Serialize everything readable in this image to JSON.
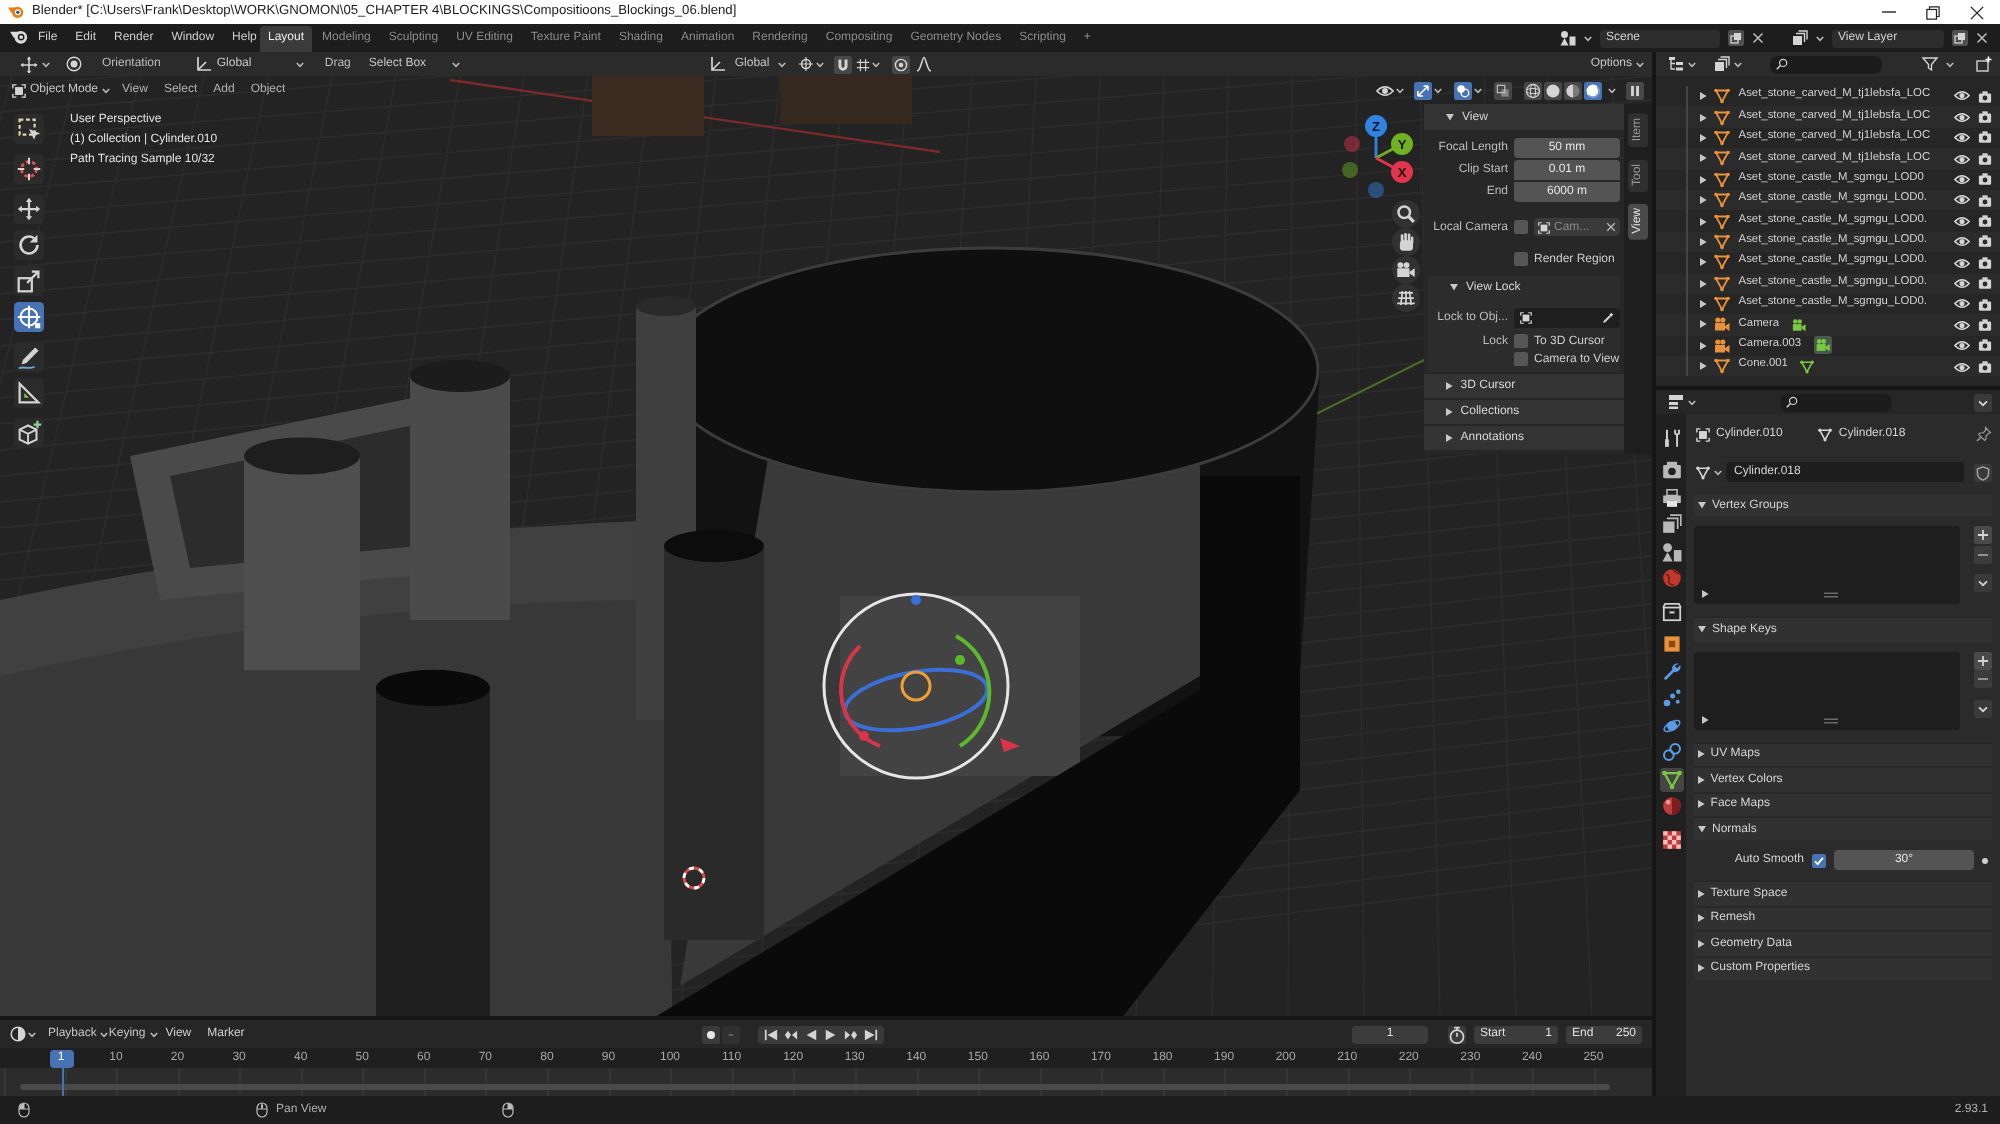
{
  "window": {
    "title": "Blender* [C:\\Users\\Frank\\Desktop\\WORK\\GNOMON\\05_CHAPTER 4\\BLOCKINGS\\Compositioons_Blockings_06.blend]"
  },
  "top_bar": {
    "menus": [
      "File",
      "Edit",
      "Render",
      "Window",
      "Help"
    ],
    "workspaces": [
      {
        "label": "Layout",
        "selected": true
      },
      {
        "label": "Modeling",
        "selected": false
      },
      {
        "label": "Sculpting",
        "selected": false
      },
      {
        "label": "UV Editing",
        "selected": false
      },
      {
        "label": "Texture Paint",
        "selected": false
      },
      {
        "label": "Shading",
        "selected": false
      },
      {
        "label": "Animation",
        "selected": false
      },
      {
        "label": "Rendering",
        "selected": false
      },
      {
        "label": "Compositing",
        "selected": false
      },
      {
        "label": "Geometry Nodes",
        "selected": false
      },
      {
        "label": "Scripting",
        "selected": false
      }
    ],
    "add_workspace": "+",
    "scene": "Scene",
    "view_layer": "View Layer"
  },
  "tool_settings": {
    "orientation_label": "Orientation",
    "orientation": "Global",
    "drag_label": "Drag",
    "drag": "Select Box",
    "transform_orientation": "Global",
    "snap": false,
    "proportional_editing": false,
    "options": "Options"
  },
  "viewport": {
    "mode": "Object Mode",
    "menus": [
      "View",
      "Select",
      "Add",
      "Object"
    ],
    "toggles": [
      {
        "kind": "gizmos",
        "on": true
      },
      {
        "kind": "overlays",
        "on": true
      },
      {
        "kind": "xray",
        "on": false
      }
    ],
    "shading": [
      {
        "kind": "wireframe",
        "selected": false
      },
      {
        "kind": "solid",
        "selected": false
      },
      {
        "kind": "material",
        "selected": false
      },
      {
        "kind": "rendered",
        "selected": true
      }
    ],
    "info": [
      "User Perspective",
      "(1) Collection | Cylinder.010",
      "Path Tracing Sample 10/32"
    ],
    "tool_groups": [
      [
        {
          "kind": "select-box",
          "selected": false
        }
      ],
      [
        {
          "kind": "cursor",
          "selected": false
        }
      ],
      [
        {
          "kind": "move",
          "selected": false
        },
        {
          "kind": "rotate",
          "selected": false
        },
        {
          "kind": "scale",
          "selected": false
        },
        {
          "kind": "transform",
          "selected": true
        }
      ],
      [
        {
          "kind": "annotate",
          "selected": false
        },
        {
          "kind": "measure",
          "selected": false
        }
      ],
      [
        {
          "kind": "add-cube",
          "selected": false
        }
      ]
    ],
    "axes": [
      {
        "label": "Z",
        "color": "#2f84e3"
      },
      {
        "label": "Y",
        "color": "#6fb122"
      },
      {
        "label": "X",
        "color": "#e3344d"
      }
    ]
  },
  "sidebar": {
    "tabs": [
      {
        "label": "Item",
        "selected": false
      },
      {
        "label": "Tool",
        "selected": false
      },
      {
        "label": "View",
        "selected": true
      }
    ],
    "view_panel": {
      "title": "View",
      "expanded": true,
      "fields": [
        {
          "label": "Focal Length",
          "value": "50 mm"
        },
        {
          "label": "Clip Start",
          "value": "0.01 m"
        },
        {
          "label": "End",
          "value": "6000 m"
        }
      ],
      "local_camera": {
        "label": "Local Camera",
        "checked": false,
        "value": "Cam...",
        "disabled": true
      },
      "render_region": {
        "label": "Render Region",
        "checked": false
      },
      "view_lock": {
        "title": "View Lock",
        "expanded": true,
        "lock_object_label": "Lock to Obj...",
        "lock_label": "Lock",
        "options": [
          {
            "label": "To 3D Cursor",
            "checked": false
          },
          {
            "label": "Camera to View",
            "checked": false
          }
        ]
      }
    },
    "panels": [
      {
        "title": "3D Cursor",
        "expanded": false
      },
      {
        "title": "Collections",
        "expanded": false
      },
      {
        "title": "Annotations",
        "expanded": false
      }
    ]
  },
  "outliner": {
    "rows": [
      {
        "name": "Aset_stone_carved_M_tj1lebsfa_LOC",
        "kind": "mesh"
      },
      {
        "name": "Aset_stone_carved_M_tj1lebsfa_LOC",
        "kind": "mesh"
      },
      {
        "name": "Aset_stone_carved_M_tj1lebsfa_LOC",
        "kind": "mesh"
      },
      {
        "name": "Aset_stone_carved_M_tj1lebsfa_LOC",
        "kind": "mesh"
      },
      {
        "name": "Aset_stone_castle_M_sgmgu_LOD0",
        "kind": "mesh"
      },
      {
        "name": "Aset_stone_castle_M_sgmgu_LOD0.",
        "kind": "mesh"
      },
      {
        "name": "Aset_stone_castle_M_sgmgu_LOD0.",
        "kind": "mesh"
      },
      {
        "name": "Aset_stone_castle_M_sgmgu_LOD0.",
        "kind": "mesh"
      },
      {
        "name": "Aset_stone_castle_M_sgmgu_LOD0.",
        "kind": "mesh"
      },
      {
        "name": "Aset_stone_castle_M_sgmgu_LOD0.",
        "kind": "mesh"
      },
      {
        "name": "Aset_stone_castle_M_sgmgu_LOD0.",
        "kind": "mesh"
      },
      {
        "name": "Camera",
        "kind": "camera",
        "data": {
          "active": false
        }
      },
      {
        "name": "Camera.003",
        "kind": "camera",
        "data": {
          "active": true
        }
      },
      {
        "name": "Cone.001",
        "kind": "mesh",
        "data": {
          "active": false
        }
      }
    ]
  },
  "properties": {
    "tab_groups": [
      [
        {
          "kind": "tool",
          "selected": false
        }
      ],
      [
        {
          "kind": "render",
          "selected": false
        },
        {
          "kind": "output",
          "selected": false
        },
        {
          "kind": "view-layer",
          "selected": false
        },
        {
          "kind": "scene",
          "selected": false
        },
        {
          "kind": "world",
          "selected": false
        }
      ],
      [
        {
          "kind": "collection",
          "selected": false
        }
      ],
      [
        {
          "kind": "object",
          "selected": false
        },
        {
          "kind": "modifiers",
          "selected": false
        },
        {
          "kind": "particles",
          "selected": false
        },
        {
          "kind": "physics",
          "selected": false
        },
        {
          "kind": "constraints",
          "selected": false
        },
        {
          "kind": "data",
          "selected": true
        },
        {
          "kind": "material",
          "selected": false
        }
      ],
      [
        {
          "kind": "texture",
          "selected": false
        }
      ]
    ],
    "object": "Cylinder.010",
    "mesh": "Cylinder.018",
    "datablock": "Cylinder.018",
    "panels": [
      {
        "title": "Vertex Groups",
        "expanded": true,
        "kind": "list"
      },
      {
        "title": "Shape Keys",
        "expanded": true,
        "kind": "list"
      },
      {
        "title": "UV Maps",
        "expanded": false
      },
      {
        "title": "Vertex Colors",
        "expanded": false
      },
      {
        "title": "Face Maps",
        "expanded": false
      },
      {
        "title": "Normals",
        "expanded": true,
        "kind": "normals",
        "auto_smooth": {
          "label": "Auto Smooth",
          "checked": true,
          "value": "30°"
        }
      },
      {
        "title": "Texture Space",
        "expanded": false
      },
      {
        "title": "Remesh",
        "expanded": false
      },
      {
        "title": "Geometry Data",
        "expanded": false
      },
      {
        "title": "Custom Properties",
        "expanded": false
      }
    ]
  },
  "timeline": {
    "dropdowns": [
      "Playback",
      "Keying"
    ],
    "menus": [
      "View",
      "Marker"
    ],
    "auto_keying": false,
    "current_frame": "1",
    "start_label": "Start",
    "start": "1",
    "end_label": "End",
    "end": "250",
    "playhead": "1",
    "ticks": [
      "10",
      "20",
      "30",
      "40",
      "50",
      "60",
      "70",
      "80",
      "90",
      "100",
      "110",
      "120",
      "130",
      "140",
      "150",
      "160",
      "170",
      "180",
      "190",
      "200",
      "210",
      "220",
      "230",
      "240",
      "250"
    ]
  },
  "status_bar": {
    "hint": "Pan View",
    "version": "2.93.1"
  }
}
